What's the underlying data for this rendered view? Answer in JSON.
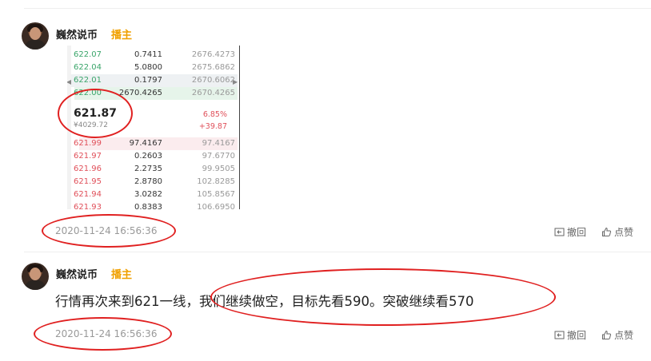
{
  "posts": [
    {
      "author": "巍然说币",
      "role": "播主",
      "timestamp": "2020-11-24 16:56:36",
      "actions": {
        "withdraw": "撤回",
        "like": "点赞"
      }
    },
    {
      "author": "巍然说币",
      "role": "播主",
      "text": "行情再次来到621一线，我们继续做空，目标先看590。突破继续看570",
      "timestamp": "2020-11-24 16:56:36",
      "actions": {
        "withdraw": "撤回",
        "like": "点赞"
      }
    }
  ],
  "orderbook": {
    "asks": [
      {
        "price": "622.07",
        "qty": "0.7411",
        "total": "2676.4273"
      },
      {
        "price": "622.04",
        "qty": "5.0800",
        "total": "2675.6862"
      },
      {
        "price": "622.01",
        "qty": "0.1797",
        "total": "2670.6062"
      },
      {
        "price": "622.00",
        "qty": "2670.4265",
        "total": "2670.4265"
      }
    ],
    "current": {
      "price": "621.87",
      "cny": "¥4029.72",
      "change_pct": "6.85%",
      "change": "+39.87"
    },
    "bids": [
      {
        "price": "621.99",
        "qty": "97.4167",
        "total": "97.4167"
      },
      {
        "price": "621.97",
        "qty": "0.2603",
        "total": "97.6770"
      },
      {
        "price": "621.96",
        "qty": "2.2735",
        "total": "99.9505"
      },
      {
        "price": "621.95",
        "qty": "2.8780",
        "total": "102.8285"
      },
      {
        "price": "621.94",
        "qty": "3.0282",
        "total": "105.8567"
      },
      {
        "price": "621.93",
        "qty": "0.8383",
        "total": "106.6950"
      }
    ]
  },
  "colors": {
    "role": "#f0a000",
    "annotation": "#e02020",
    "ask": "#3aa56a",
    "bid": "#e0505a"
  }
}
